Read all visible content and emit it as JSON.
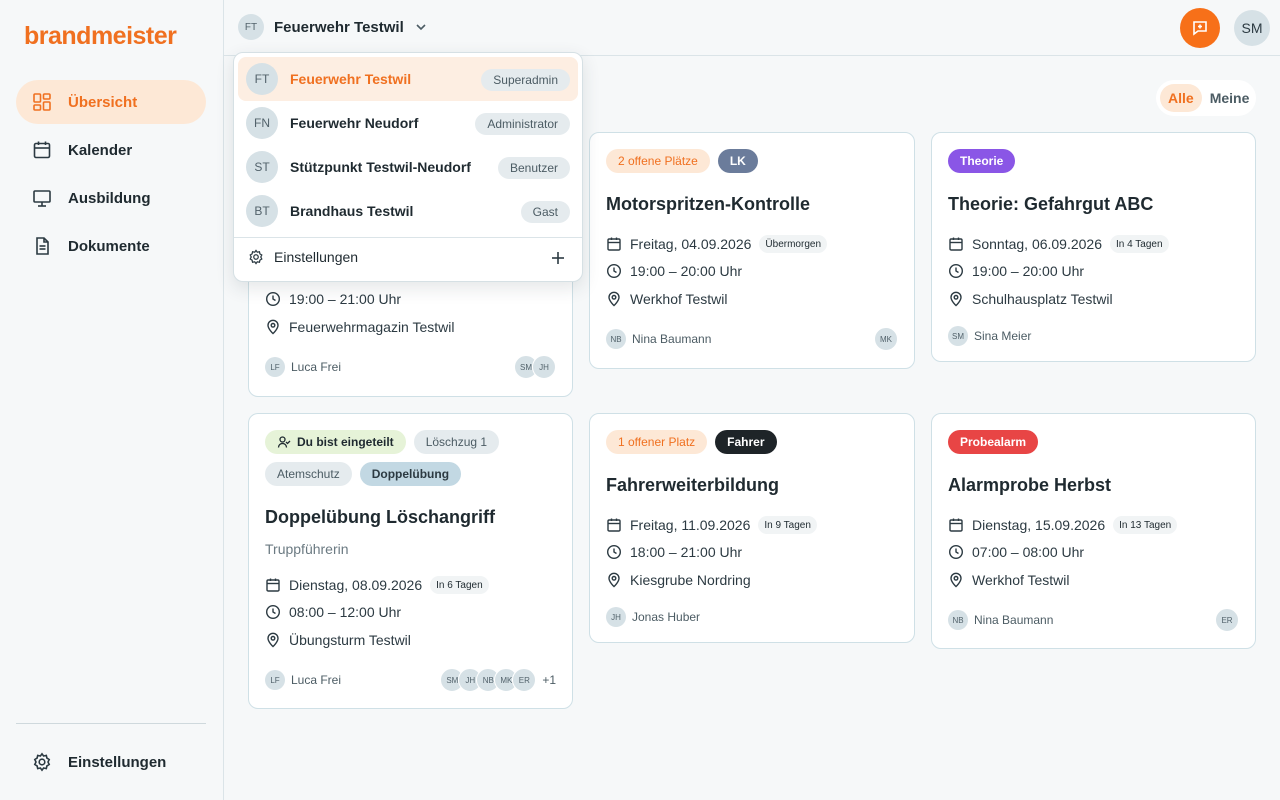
{
  "app": {
    "logo": "brandmeister"
  },
  "colors": {
    "accent": "#f07020",
    "accent_bg": "#fde8d6",
    "purple": "#8a56e6",
    "red": "#e84545",
    "slate": "#6b7c9b"
  },
  "sidebar": {
    "items": [
      {
        "label": "Übersicht",
        "icon": "dashboard-icon"
      },
      {
        "label": "Kalender",
        "icon": "calendar-icon"
      },
      {
        "label": "Ausbildung",
        "icon": "presentation-icon"
      },
      {
        "label": "Dokumente",
        "icon": "document-icon"
      }
    ],
    "settings_label": "Einstellungen"
  },
  "header": {
    "org_initials": "FT",
    "org_name": "Feuerwehr Testwil",
    "user_initials": "SM"
  },
  "org_dropdown": {
    "orgs": [
      {
        "initials": "FT",
        "name": "Feuerwehr Testwil",
        "role": "Superadmin"
      },
      {
        "initials": "FN",
        "name": "Feuerwehr Neudorf",
        "role": "Administrator"
      },
      {
        "initials": "ST",
        "name": "Stützpunkt Testwil-Neudorf",
        "role": "Benutzer"
      },
      {
        "initials": "BT",
        "name": "Brandhaus Testwil",
        "role": "Gast"
      }
    ],
    "settings_label": "Einstellungen"
  },
  "filter": {
    "all": "Alle",
    "mine": "Meine"
  },
  "cards": [
    {
      "time": "19:00 – 21:00 Uhr",
      "location": "Feuerwehrmagazin Testwil",
      "organizer_initials": "LF",
      "organizer": "Luca Frei",
      "participants": [
        "SM",
        "JH"
      ]
    },
    {
      "badges": [
        "2 offene Plätze",
        "LK"
      ],
      "title": "Motorspritzen-Kontrolle",
      "date": "Freitag, 04.09.2026",
      "relative": "Übermorgen",
      "time": "19:00 – 20:00 Uhr",
      "location": "Werkhof Testwil",
      "organizer_initials": "NB",
      "organizer": "Nina Baumann",
      "participants": [
        "MK"
      ]
    },
    {
      "badges": [
        "Theorie"
      ],
      "title": "Theorie: Gefahrgut ABC",
      "date": "Sonntag, 06.09.2026",
      "relative": "In 4 Tagen",
      "time": "19:00 – 20:00 Uhr",
      "location": "Schulhausplatz Testwil",
      "organizer_initials": "SM",
      "organizer": "Sina Meier"
    },
    {
      "badges": [
        "Du bist eingeteilt",
        "Löschzug 1",
        "Atemschutz",
        "Doppelübung"
      ],
      "title": "Doppelübung Löschangriff",
      "subtitle": "Truppführerin",
      "date": "Dienstag, 08.09.2026",
      "relative": "In 6 Tagen",
      "time": "08:00 – 12:00 Uhr",
      "location": "Übungsturm Testwil",
      "organizer_initials": "LF",
      "organizer": "Luca Frei",
      "participants": [
        "SM",
        "JH",
        "NB",
        "MK",
        "ER"
      ],
      "more": "+1"
    },
    {
      "badges": [
        "1 offener Platz",
        "Fahrer"
      ],
      "title": "Fahrerweiterbildung",
      "date": "Freitag, 11.09.2026",
      "relative": "In 9 Tagen",
      "time": "18:00 – 21:00 Uhr",
      "location": "Kiesgrube Nordring",
      "organizer_initials": "JH",
      "organizer": "Jonas Huber"
    },
    {
      "badges": [
        "Probealarm"
      ],
      "title": "Alarmprobe Herbst",
      "date": "Dienstag, 15.09.2026",
      "relative": "In 13 Tagen",
      "time": "07:00 – 08:00 Uhr",
      "location": "Werkhof Testwil",
      "organizer_initials": "NB",
      "organizer": "Nina Baumann",
      "participants": [
        "ER"
      ]
    }
  ]
}
